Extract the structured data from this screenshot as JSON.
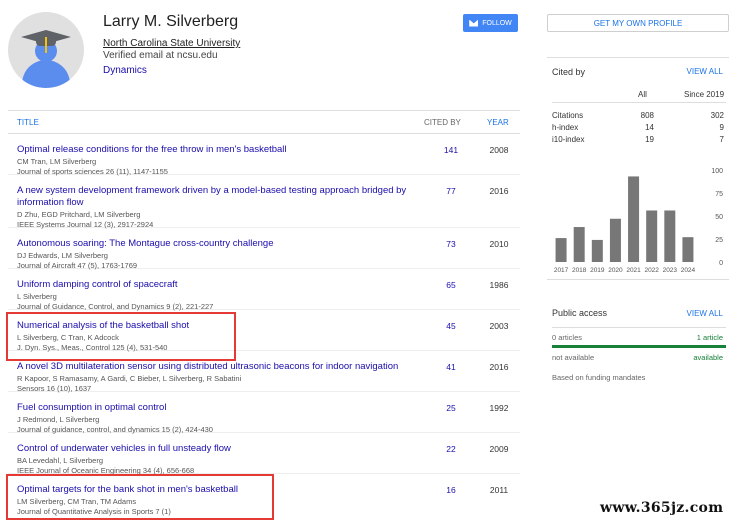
{
  "profile": {
    "name": "Larry M. Silverberg",
    "affiliation": "North Carolina State University",
    "email": "Verified email at ncsu.edu",
    "interest": "Dynamics",
    "follow_label": "FOLLOW",
    "get_profile_label": "GET MY OWN PROFILE"
  },
  "table": {
    "headers": {
      "title": "TITLE",
      "cited_by": "CITED BY",
      "year": "YEAR"
    },
    "rows": [
      {
        "title": "Optimal release conditions for the free throw in men's basketball",
        "authors": "CM Tran, LM Silverberg",
        "venue": "Journal of sports sciences 26 (11), 1147-1155",
        "cited": "141",
        "year": "2008"
      },
      {
        "title": "A new system development framework driven by a model-based testing approach bridged by information flow",
        "authors": "D Zhu, EGD Pritchard, LM Silverberg",
        "venue": "IEEE Systems Journal 12 (3), 2917-2924",
        "cited": "77",
        "year": "2016"
      },
      {
        "title": "Autonomous soaring: The Montague cross-country challenge",
        "authors": "DJ Edwards, LM Silverberg",
        "venue": "Journal of Aircraft 47 (5), 1763-1769",
        "cited": "73",
        "year": "2010"
      },
      {
        "title": "Uniform damping control of spacecraft",
        "authors": "L Silverberg",
        "venue": "Journal of Guidance, Control, and Dynamics 9 (2), 221-227",
        "cited": "65",
        "year": "1986"
      },
      {
        "title": "Numerical analysis of the basketball shot",
        "authors": "L Silverberg, C Tran, K Adcock",
        "venue": "J. Dyn. Sys., Meas., Control 125 (4), 531-540",
        "cited": "45",
        "year": "2003"
      },
      {
        "title": "A novel 3D multilateration sensor using distributed ultrasonic beacons for indoor navigation",
        "authors": "R Kapoor, S Ramasamy, A Gardi, C Bieber, L Silverberg, R Sabatini",
        "venue": "Sensors 16 (10), 1637",
        "cited": "41",
        "year": "2016"
      },
      {
        "title": "Fuel consumption in optimal control",
        "authors": "J Redmond, L Silverberg",
        "venue": "Journal of guidance, control, and dynamics 15 (2), 424-430",
        "cited": "25",
        "year": "1992"
      },
      {
        "title": "Control of underwater vehicles in full unsteady flow",
        "authors": "BA Levedahl, L Silverberg",
        "venue": "IEEE Journal of Oceanic Engineering 34 (4), 656-668",
        "cited": "22",
        "year": "2009"
      },
      {
        "title": "Optimal targets for the bank shot in men's basketball",
        "authors": "LM Silverberg, CM Tran, TM Adams",
        "venue": "Journal of Quantitative Analysis in Sports 7 (1)",
        "cited": "16",
        "year": "2011"
      }
    ]
  },
  "cited_by": {
    "title": "Cited by",
    "view_all": "VIEW ALL",
    "col_all": "All",
    "col_since": "Since 2019",
    "stats": [
      {
        "label": "Citations",
        "all": "808",
        "since": "302"
      },
      {
        "label": "h-index",
        "all": "14",
        "since": "9"
      },
      {
        "label": "i10-index",
        "all": "19",
        "since": "7"
      }
    ]
  },
  "chart_data": {
    "type": "bar",
    "categories": [
      "2017",
      "2018",
      "2019",
      "2020",
      "2021",
      "2022",
      "2023",
      "2024"
    ],
    "values": [
      26,
      38,
      24,
      47,
      93,
      56,
      56,
      27
    ],
    "ylim": [
      0,
      100
    ],
    "yticks": [
      "100",
      "75",
      "50",
      "25",
      "0"
    ],
    "bar_color": "#777777"
  },
  "public_access": {
    "title": "Public access",
    "view_all": "VIEW ALL",
    "left_count": "0 articles",
    "right_count": "1 article",
    "left_status": "not available",
    "right_status": "available",
    "note": "Based on funding mandates"
  },
  "watermark": "www.365jz.com"
}
